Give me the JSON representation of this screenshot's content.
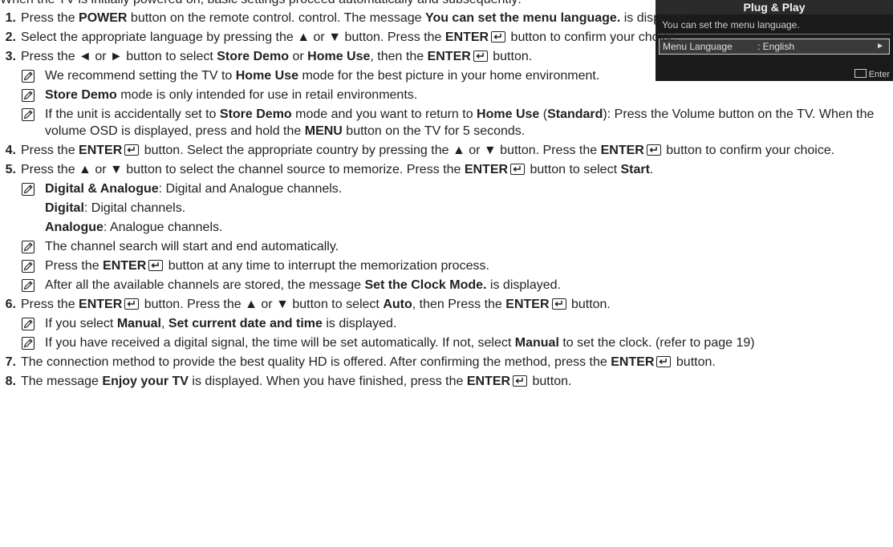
{
  "intro_text": "When the TV is initially powered on, basic settings proceed automatically and subsequently:",
  "osd": {
    "title": "Plug & Play",
    "message": "You can set the menu language.",
    "row_label": "Menu Language",
    "row_value": ": English",
    "row_arrow": "►",
    "footer": "Enter"
  },
  "steps": [
    {
      "num": "1.",
      "segs": [
        "Press the ",
        "POWER",
        " button on the remote control. control. The message ",
        "You can set the menu language.",
        " is displayed."
      ]
    },
    {
      "num": "2.",
      "segs": [
        "Select the appropriate language by pressing the ▲ or ▼ button. Press the ",
        "ENTER",
        " button to confirm your choice."
      ]
    },
    {
      "num": "3.",
      "segs": [
        "Press the ◄ or ► button to select ",
        "Store Demo",
        " or ",
        "Home Use",
        ", then the ",
        "ENTER",
        " button."
      ],
      "notes": [
        [
          "We recommend setting the TV to ",
          "Home Use",
          " mode for the best picture in your home environment."
        ],
        [
          "",
          "Store Demo",
          " mode is only intended for use in retail environments."
        ],
        [
          "If the unit is accidentally set to ",
          "Store Demo",
          " mode and you want to return to ",
          "Home Use",
          " (",
          "Standard",
          "): Press the Volume button on the TV. When the volume OSD is displayed, press and hold the ",
          "MENU",
          " button on the TV for 5 seconds."
        ]
      ]
    },
    {
      "num": "4.",
      "segs": [
        "Press the ",
        "ENTER",
        " button. Select the appropriate country by pressing the ▲ or ▼ button. Press the ",
        "ENTER",
        " button to confirm your choice."
      ]
    },
    {
      "num": "5.",
      "segs": [
        "Press the ▲ or ▼ button to select the channel source to memorize. Press the ",
        "ENTER",
        " button to select ",
        "Start",
        "."
      ],
      "sources": [
        [
          "",
          "Digital & Analogue",
          ": Digital and Analogue channels."
        ],
        [
          "",
          "Digital",
          ": Digital channels."
        ],
        [
          "",
          "Analogue",
          ": Analogue channels."
        ]
      ],
      "notes": [
        [
          "The channel search will start and end automatically."
        ],
        [
          "Press the ",
          "ENTER",
          " button at any time to interrupt the memorization process."
        ],
        [
          "After all the available channels are stored, the message ",
          "Set the Clock Mode.",
          " is displayed."
        ]
      ]
    },
    {
      "num": "6.",
      "segs": [
        "Press the ",
        "ENTER",
        " button. Press the ▲ or ▼ button to select ",
        "Auto",
        ", then Press the ",
        "ENTER",
        " button."
      ],
      "notes": [
        [
          "If you select ",
          "Manual",
          ", ",
          "Set current date and time",
          " is displayed."
        ],
        [
          "If you have received a digital signal, the time will be set automatically. If not, select ",
          "Manual",
          " to set the clock. (refer to page 19)"
        ]
      ]
    },
    {
      "num": "7.",
      "segs": [
        "The connection method to provide the best quality HD is offered. After confirming the method, press the ",
        "ENTER",
        " button."
      ]
    },
    {
      "num": "8.",
      "segs": [
        "The message ",
        "Enjoy your TV",
        " is displayed. When you have finished, press the ",
        "ENTER",
        " button."
      ]
    }
  ]
}
